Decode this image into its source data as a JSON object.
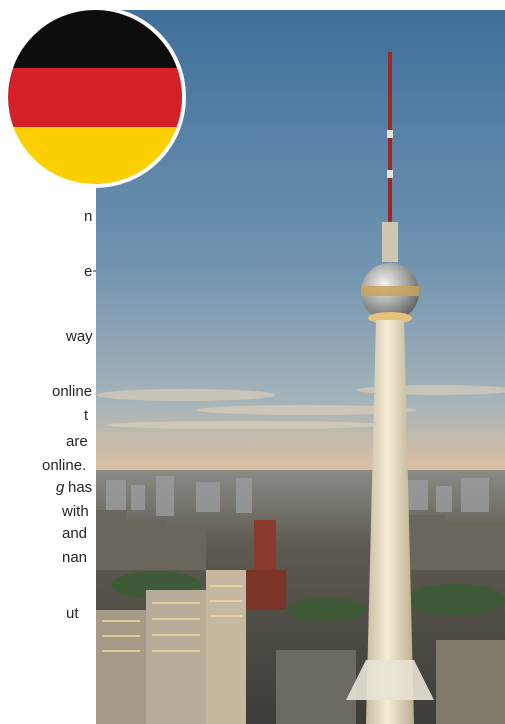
{
  "flag": {
    "name": "german-flag",
    "colors": [
      "#0d0d0d",
      "#d42027",
      "#fccf00"
    ]
  },
  "text_fragments": [
    {
      "text": "n",
      "italic": false
    },
    {
      "text": "e+,",
      "italic": false
    },
    {
      "text": "way",
      "italic": false
    },
    {
      "text": "online",
      "italic": false
    },
    {
      "text": "t",
      "italic": false
    },
    {
      "text": "are",
      "italic": false
    },
    {
      "text": "online.",
      "italic": false
    },
    {
      "text": "g",
      "italic": true
    },
    {
      "text": "has",
      "italic": false
    },
    {
      "text": "with",
      "italic": false
    },
    {
      "text": "and",
      "italic": false
    },
    {
      "text": "nan",
      "italic": false
    },
    {
      "text": "ut",
      "italic": false
    }
  ],
  "photo": {
    "subject": "tv-tower-skyline-icon",
    "colors": {
      "sky_top": "#3f6f9c",
      "sky_mid": "#8fa6b6",
      "horizon": "#f0c79a",
      "tower": "#efe6cf",
      "city": "#5e5a50"
    }
  }
}
